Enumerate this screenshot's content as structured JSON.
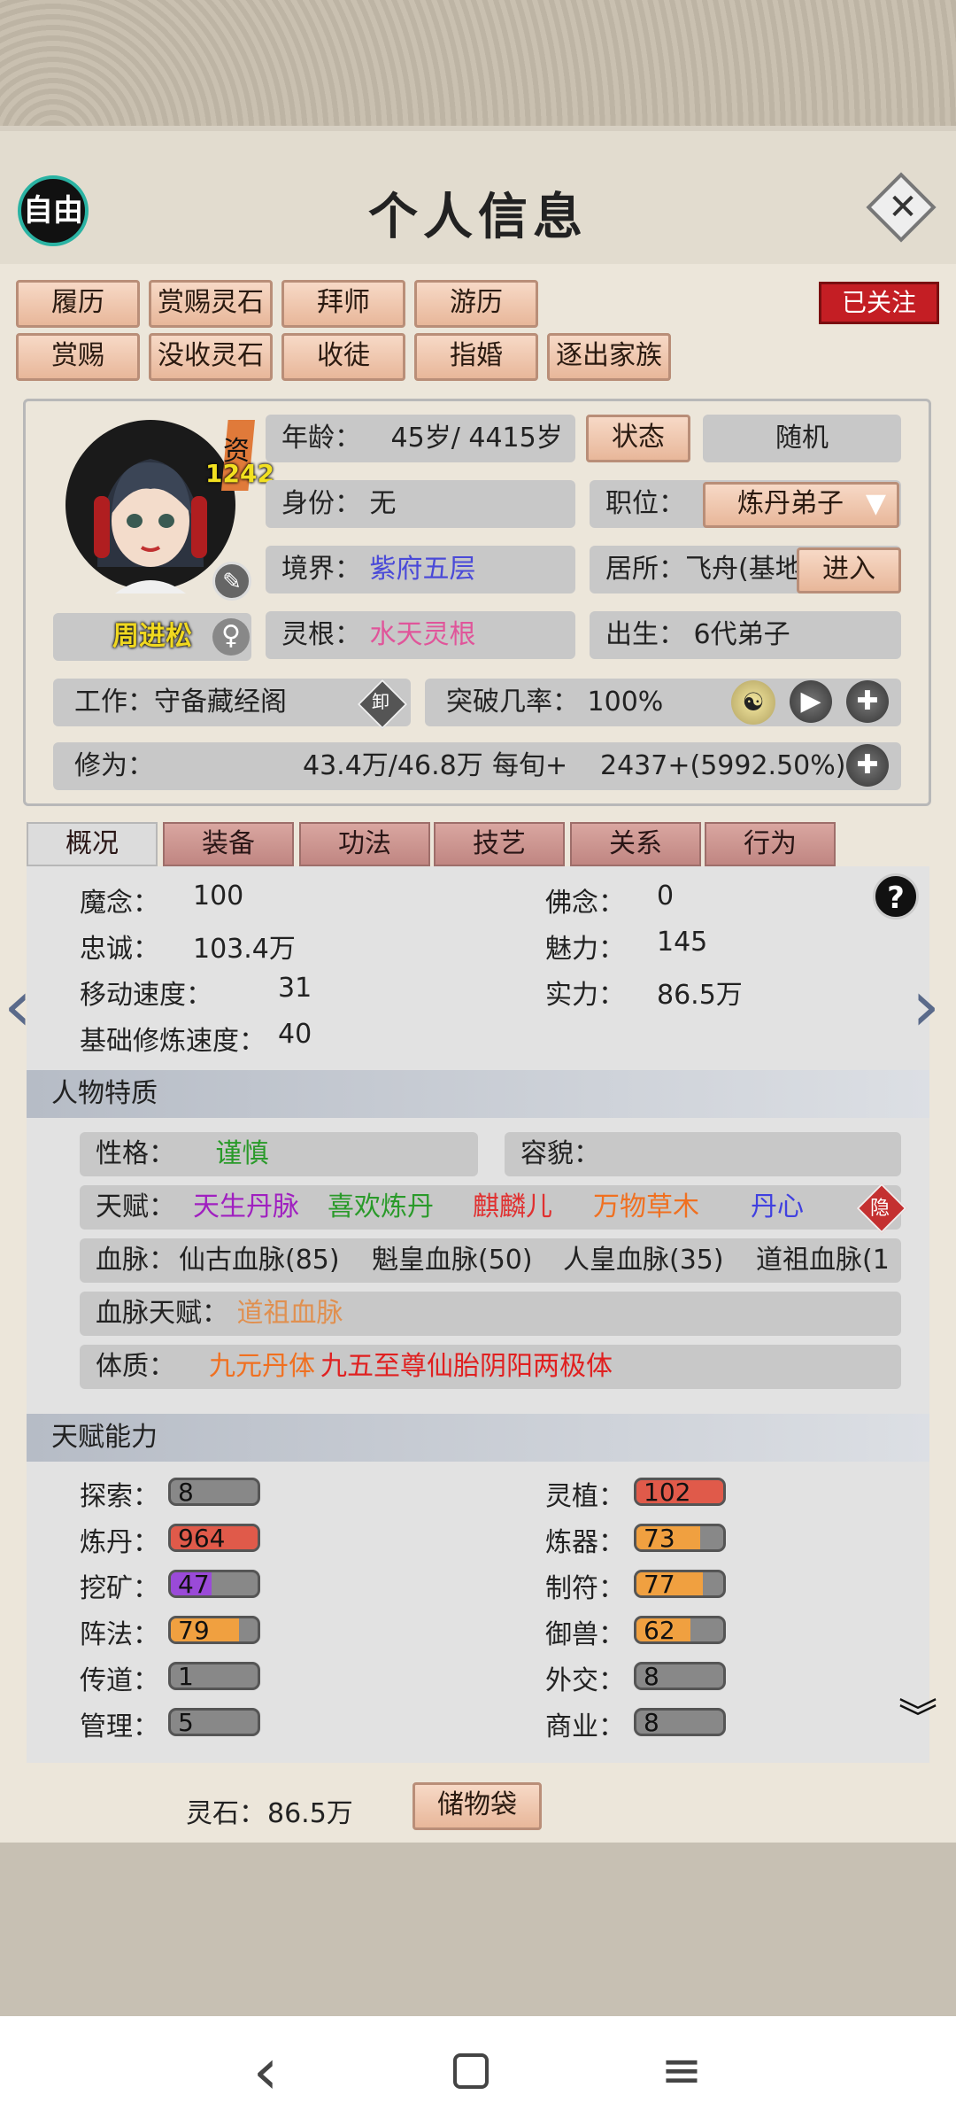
{
  "header": {
    "mode_badge": "自由",
    "title": "个人信息",
    "close_icon": "close-icon"
  },
  "actions_row1": [
    "履历",
    "赏赐灵石",
    "拜师",
    "游历"
  ],
  "actions_row2": [
    "赏赐",
    "没收灵石",
    "收徒",
    "指婚",
    "逐出家族"
  ],
  "follow_badge": "已关注",
  "profile": {
    "aptitude_label": "资",
    "aptitude_value": "1242",
    "name": "周进松",
    "age_label": "年龄：",
    "age_value": "45岁/ 4415岁",
    "status_button": "状态",
    "random_button": "随机",
    "identity_label": "身份：",
    "identity_value": "无",
    "position_label": "职位：",
    "position_value": "炼丹弟子",
    "realm_label": "境界：",
    "realm_value": "紫府五层",
    "residence_label": "居所：",
    "residence_value": "飞舟(基地",
    "enter_button": "进入",
    "root_label": "灵根：",
    "root_value": "水天灵根",
    "birth_label": "出生：",
    "birth_value": "6代弟子",
    "work_label": "工作：",
    "work_value": "守备藏经阁",
    "unload_badge": "卸",
    "breakthrough_label": "突破几率：",
    "breakthrough_value": "100%",
    "cultivation_label": "修为：",
    "cultivation_value": "43.4万/46.8万",
    "per_tick_label": "每旬+",
    "per_tick_value": "2437+(5992.50%)"
  },
  "tabs": [
    {
      "label": "概况",
      "active": true
    },
    {
      "label": "装备"
    },
    {
      "label": "功法"
    },
    {
      "label": "技艺"
    },
    {
      "label": "关系"
    },
    {
      "label": "行为"
    }
  ],
  "overview": {
    "left": [
      {
        "label": "魔念：",
        "value": "100"
      },
      {
        "label": "忠诚：",
        "value": "103.4万"
      },
      {
        "label": "移动速度：",
        "value": "31"
      },
      {
        "label": "基础修炼速度：",
        "value": "40"
      }
    ],
    "right": [
      {
        "label": "佛念：",
        "value": "0"
      },
      {
        "label": "魅力：",
        "value": "145"
      },
      {
        "label": "实力：",
        "value": "86.5万"
      }
    ]
  },
  "traits": {
    "section_title": "人物特质",
    "personality_label": "性格：",
    "personality_value": "谨慎",
    "appearance_label": "容貌：",
    "talent_label": "天赋：",
    "talents": [
      "天生丹脉",
      "喜欢炼丹",
      "麒麟儿",
      "万物草木",
      "丹心"
    ],
    "talent_colors": [
      "#a020c0",
      "#2a9a2a",
      "#e03030",
      "#f07020",
      "#4040e0"
    ],
    "hide_badge": "隐",
    "blood_label": "血脉：",
    "bloodlines": [
      "仙古血脉(85)",
      "魁皇血脉(50)",
      "人皇血脉(35)",
      "道祖血脉(1"
    ],
    "blood_talent_label": "血脉天赋：",
    "blood_talent_value": "道祖血脉",
    "physique_label": "体质：",
    "physique_value": "九元丹体",
    "physique_value2": "九五至尊仙胎阴阳两极体"
  },
  "abilities": {
    "section_title": "天赋能力",
    "left": [
      {
        "label": "探索：",
        "value": "8",
        "level": 0.0,
        "color": "#888888"
      },
      {
        "label": "炼丹：",
        "value": "964",
        "level": 1.0,
        "color": "#e05a4a"
      },
      {
        "label": "挖矿：",
        "value": "47",
        "level": 0.47,
        "color": "#9a4ad8"
      },
      {
        "label": "阵法：",
        "value": "79",
        "level": 0.79,
        "color": "#f0a040"
      },
      {
        "label": "传道：",
        "value": "1",
        "level": 0.0,
        "color": "#888888"
      },
      {
        "label": "管理：",
        "value": "5",
        "level": 0.0,
        "color": "#888888"
      }
    ],
    "right": [
      {
        "label": "灵植：",
        "value": "102",
        "level": 1.0,
        "color": "#e05a4a"
      },
      {
        "label": "炼器：",
        "value": "73",
        "level": 0.73,
        "color": "#f0a040"
      },
      {
        "label": "制符：",
        "value": "77",
        "level": 0.77,
        "color": "#f0a040"
      },
      {
        "label": "御兽：",
        "value": "62",
        "level": 0.62,
        "color": "#f0a040"
      },
      {
        "label": "外交：",
        "value": "8",
        "level": 0.0,
        "color": "#888888"
      },
      {
        "label": "商业：",
        "value": "8",
        "level": 0.0,
        "color": "#888888"
      }
    ]
  },
  "footer": {
    "spirit_stone_label": "灵石：",
    "spirit_stone_value": "86.5万",
    "storage_button": "储物袋"
  },
  "nav": {
    "back": "‹",
    "home": "□",
    "menu": "≡"
  }
}
